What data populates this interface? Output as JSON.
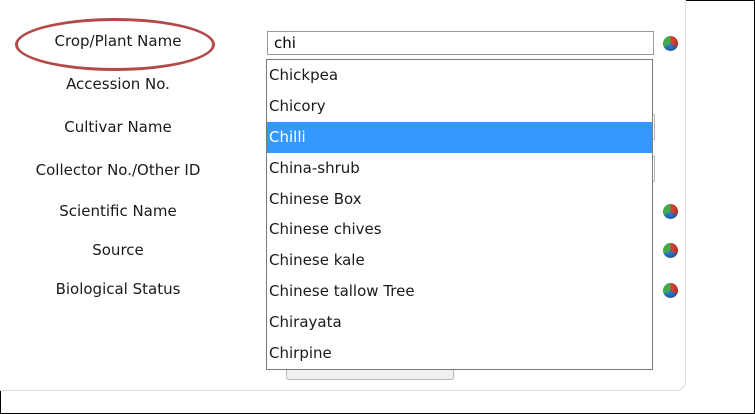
{
  "form": {
    "labels": {
      "crop_name": "Crop/Plant Name",
      "accession_no": "Accession No.",
      "cultivar_name": "Cultivar Name",
      "collector_no": "Collector No./Other ID",
      "scientific_name": "Scientific Name",
      "source": "Source",
      "biological_status": "Biological Status"
    },
    "crop_input_value": "chi",
    "annotation_color": "#b34a4a"
  },
  "dropdown": {
    "selected_index": 2,
    "options": [
      "Chickpea",
      "Chicory",
      "Chilli",
      "China-shrub",
      "Chinese Box",
      "Chinese chives",
      "Chinese kale",
      "Chinese tallow Tree",
      "Chirayata",
      "Chirpine"
    ],
    "highlight_color": "#3399ff"
  },
  "icons": {
    "lookup": "globe-icon"
  }
}
